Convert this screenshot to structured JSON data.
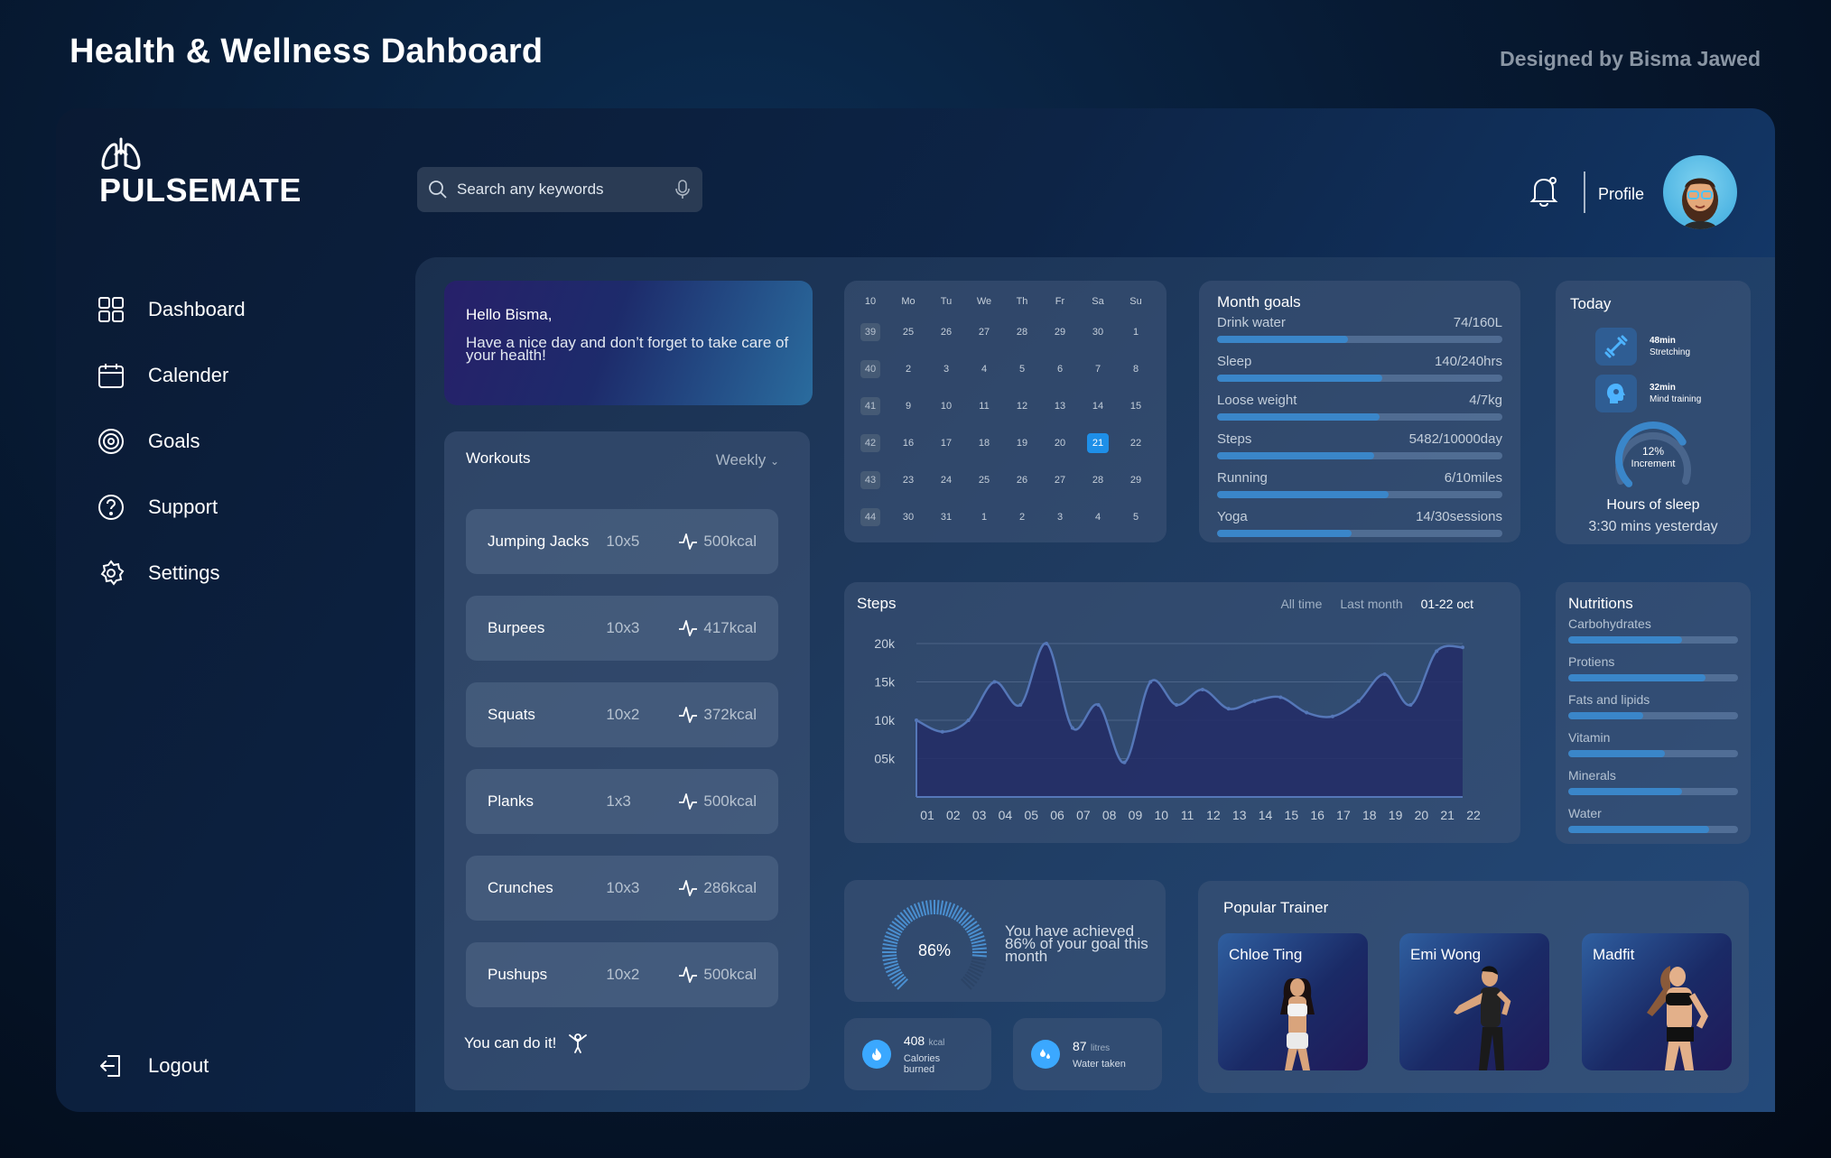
{
  "page_title": "Health & Wellness Dahboard",
  "credit": "Designed by Bisma Jawed",
  "brand": "PULSEMATE",
  "search": {
    "placeholder": "Search any keywords"
  },
  "header": {
    "profile_label": "Profile"
  },
  "nav": {
    "items": [
      "Dashboard",
      "Calender",
      "Goals",
      "Support",
      "Settings"
    ],
    "logout": "Logout"
  },
  "greeting": {
    "hello": "Hello ",
    "name": "Bisma,",
    "message": "Have a nice day and don’t forget to take care of your health!"
  },
  "workouts": {
    "title": "Workouts",
    "period": "Weekly",
    "items": [
      {
        "name": "Jumping Jacks",
        "reps": "10x5",
        "kcal": "500kcal"
      },
      {
        "name": "Burpees",
        "reps": "10x3",
        "kcal": "417kcal"
      },
      {
        "name": "Squats",
        "reps": "10x2",
        "kcal": "372kcal"
      },
      {
        "name": "Planks",
        "reps": "1x3",
        "kcal": "500kcal"
      },
      {
        "name": "Crunches",
        "reps": "10x3",
        "kcal": "286kcal"
      },
      {
        "name": "Pushups",
        "reps": "10x2",
        "kcal": "500kcal"
      }
    ],
    "footer": "You can do it!"
  },
  "calendar": {
    "week_label": "10",
    "days": [
      "Mo",
      "Tu",
      "We",
      "Th",
      "Fr",
      "Sa",
      "Su"
    ],
    "weeks": [
      {
        "wk": "39",
        "d": [
          "25",
          "26",
          "27",
          "28",
          "29",
          "30",
          "1"
        ]
      },
      {
        "wk": "40",
        "d": [
          "2",
          "3",
          "4",
          "5",
          "6",
          "7",
          "8"
        ]
      },
      {
        "wk": "41",
        "d": [
          "9",
          "10",
          "11",
          "12",
          "13",
          "14",
          "15"
        ]
      },
      {
        "wk": "42",
        "d": [
          "16",
          "17",
          "18",
          "19",
          "20",
          "21",
          "22"
        ]
      },
      {
        "wk": "43",
        "d": [
          "23",
          "24",
          "25",
          "26",
          "27",
          "28",
          "29"
        ]
      },
      {
        "wk": "44",
        "d": [
          "30",
          "31",
          "1",
          "2",
          "3",
          "4",
          "5"
        ]
      }
    ],
    "selected": "21"
  },
  "month_goals": {
    "title": "Month goals",
    "items": [
      {
        "label": "Drink water",
        "value": "74/160L",
        "progress": 0.46
      },
      {
        "label": "Sleep",
        "value": "140/240hrs",
        "progress": 0.58
      },
      {
        "label": "Loose weight",
        "value": "4/7kg",
        "progress": 0.57
      },
      {
        "label": "Steps",
        "value": "5482/10000day",
        "progress": 0.55
      },
      {
        "label": "Running",
        "value": "6/10miles",
        "progress": 0.6
      },
      {
        "label": "Yoga",
        "value": "14/30sessions",
        "progress": 0.47
      }
    ]
  },
  "today": {
    "title": "Today",
    "activities": [
      {
        "value": "48min",
        "label": "Stretching"
      },
      {
        "value": "32min",
        "label": "Mind training"
      }
    ],
    "increment_value": "12%",
    "increment_label": "Increment",
    "sleep_title": "Hours of sleep",
    "sleep_value": "3:30 mins yesterday",
    "sleep_progress": 0.72
  },
  "steps_card": {
    "title": "Steps",
    "tabs": [
      "All time",
      "Last month",
      "01-22 oct"
    ],
    "active_tab": 2
  },
  "chart_data": {
    "type": "area",
    "title": "Steps",
    "x": [
      "01",
      "02",
      "03",
      "04",
      "05",
      "06",
      "07",
      "08",
      "09",
      "10",
      "11",
      "12",
      "13",
      "14",
      "15",
      "16",
      "17",
      "18",
      "19",
      "20",
      "21",
      "22"
    ],
    "values": [
      10000,
      8500,
      10000,
      15000,
      12000,
      20000,
      9000,
      12000,
      4500,
      15000,
      12000,
      14000,
      11500,
      12500,
      13000,
      11000,
      10500,
      12500,
      16000,
      12000,
      19000,
      19500
    ],
    "yticks": [
      "05k",
      "10k",
      "15k",
      "20k"
    ],
    "ylim": [
      0,
      20000
    ],
    "colors": {
      "line": "#5577b8",
      "fill": "#232b66"
    }
  },
  "nutritions": {
    "title": "Nutritions",
    "items": [
      {
        "label": "Carbohydrates",
        "progress": 0.67
      },
      {
        "label": "Protiens",
        "progress": 0.81
      },
      {
        "label": "Fats and lipids",
        "progress": 0.44
      },
      {
        "label": "Vitamin",
        "progress": 0.57
      },
      {
        "label": "Minerals",
        "progress": 0.67
      },
      {
        "label": "Water",
        "progress": 0.83
      }
    ]
  },
  "goal_summary": {
    "percent": "86%",
    "progress": 0.86,
    "text": "You have achieved 86% of your goal this month"
  },
  "calories": {
    "value": "408",
    "unit": "kcal",
    "label": "Calories burned"
  },
  "water": {
    "value": "87",
    "unit": "litres",
    "label": "Water taken"
  },
  "trainers": {
    "title": "Popular Trainer",
    "items": [
      "Chloe Ting",
      "Emi Wong",
      "Madfit"
    ]
  },
  "colors": {
    "accent": "#3ba8ff",
    "bar": "#3a86c9",
    "today_cal": "#1e8fe8"
  }
}
